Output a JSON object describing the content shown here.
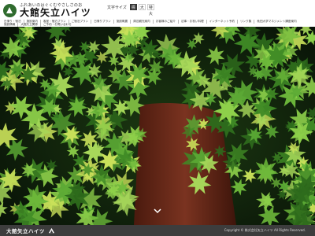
{
  "site": {
    "tagline": "ふれあいのはぐくむやさしさのお",
    "name": "大館矢立ハイツ"
  },
  "fontsize": {
    "label": "文字サイズ",
    "options": [
      "標準",
      "大",
      "特大"
    ],
    "selected": "標準"
  },
  "gnav": {
    "row1": [
      "日帰り・宿泊",
      "施設案内",
      "客室・宿泊プラン",
      "ご宿泊プラン",
      "日帰りプラン",
      "施設概要",
      "周辺観光案内",
      "お客様のご紹介",
      "法事・お祝い料理",
      "インターネット予約",
      "リンク集",
      "秋田大学マネジメント講座案内"
    ],
    "row2": [
      "施設情報",
      "大館矢立関係",
      "ご予約・お問い合わせ"
    ]
  },
  "hero": {
    "scroll_icon": "chevron-down-icon",
    "colors": {
      "leaf": "#5aa834",
      "leaf_bright": "#8ed04a",
      "trunk": "#6e2a18",
      "bg": "#0d1a0a"
    }
  },
  "footer": {
    "name": "大館矢立ハイツ",
    "copyright": "Copyright © 株式会社矢立ハイツ All Rights Reserved."
  }
}
